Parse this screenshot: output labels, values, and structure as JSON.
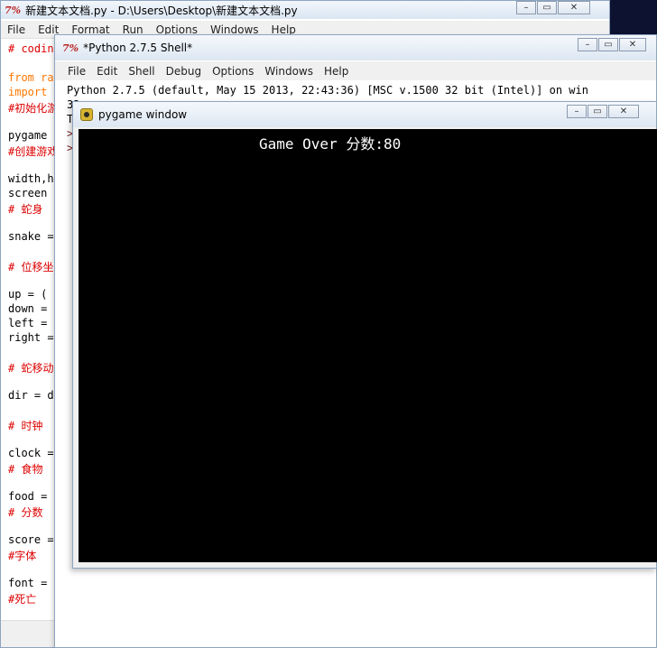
{
  "editor": {
    "title": "新建文本文档.py - D:\\Users\\Desktop\\新建文本文档.py",
    "logo": "7%",
    "menu": [
      "File",
      "Edit",
      "Format",
      "Run",
      "Options",
      "Windows",
      "Help"
    ],
    "code_lines": [
      {
        "text": "# codin",
        "style": "comment"
      },
      {
        "text": "",
        "style": "plain"
      },
      {
        "text": "from ra",
        "style": "kw"
      },
      {
        "text": "import",
        "style": "kw"
      },
      {
        "text": "#初始化游",
        "style": "comment"
      },
      {
        "text": "",
        "style": "plain"
      },
      {
        "text": "pygame",
        "style": "plain"
      },
      {
        "text": "#创建游戏",
        "style": "comment"
      },
      {
        "text": "",
        "style": "plain"
      },
      {
        "text": "width,h",
        "style": "plain"
      },
      {
        "text": "screen",
        "style": "plain"
      },
      {
        "text": "# 蛇身",
        "style": "comment"
      },
      {
        "text": "",
        "style": "plain"
      },
      {
        "text": "snake =",
        "style": "plain"
      },
      {
        "text": "",
        "style": "plain"
      },
      {
        "text": "# 位移坐",
        "style": "comment"
      },
      {
        "text": "",
        "style": "plain"
      },
      {
        "text": "up = (",
        "style": "plain"
      },
      {
        "text": "down =",
        "style": "plain"
      },
      {
        "text": "left =",
        "style": "plain"
      },
      {
        "text": "right =",
        "style": "plain"
      },
      {
        "text": "",
        "style": "plain"
      },
      {
        "text": "# 蛇移动",
        "style": "comment"
      },
      {
        "text": "",
        "style": "plain"
      },
      {
        "text": "dir = d",
        "style": "plain"
      },
      {
        "text": "",
        "style": "plain"
      },
      {
        "text": "# 时钟",
        "style": "comment"
      },
      {
        "text": "",
        "style": "plain"
      },
      {
        "text": "clock =",
        "style": "plain"
      },
      {
        "text": "# 食物",
        "style": "comment"
      },
      {
        "text": "",
        "style": "plain"
      },
      {
        "text": "food =",
        "style": "plain"
      },
      {
        "text": "# 分数",
        "style": "comment"
      },
      {
        "text": "",
        "style": "plain"
      },
      {
        "text": "score =",
        "style": "plain"
      },
      {
        "text": "#字体",
        "style": "comment"
      },
      {
        "text": "",
        "style": "plain"
      },
      {
        "text": "font =",
        "style": "plain"
      },
      {
        "text": "#死亡",
        "style": "comment"
      }
    ]
  },
  "shell": {
    "title": "*Python 2.7.5 Shell*",
    "logo": "7%",
    "menu": [
      "File",
      "Edit",
      "Shell",
      "Debug",
      "Options",
      "Windows",
      "Help"
    ],
    "output_lines": [
      "Python 2.7.5 (default, May 15 2013, 22:43:36) [MSC v.1500 32 bit (Intel)] on win",
      "32",
      "T"
    ],
    "prompts": [
      ">",
      ">"
    ]
  },
  "pygame": {
    "title": "pygame window",
    "game_text": "Game Over 分数:80"
  },
  "colors": {
    "comment": "#dd0000",
    "keyword": "#ff7700",
    "canvas": "#000000",
    "desktop": "#0c1230"
  }
}
